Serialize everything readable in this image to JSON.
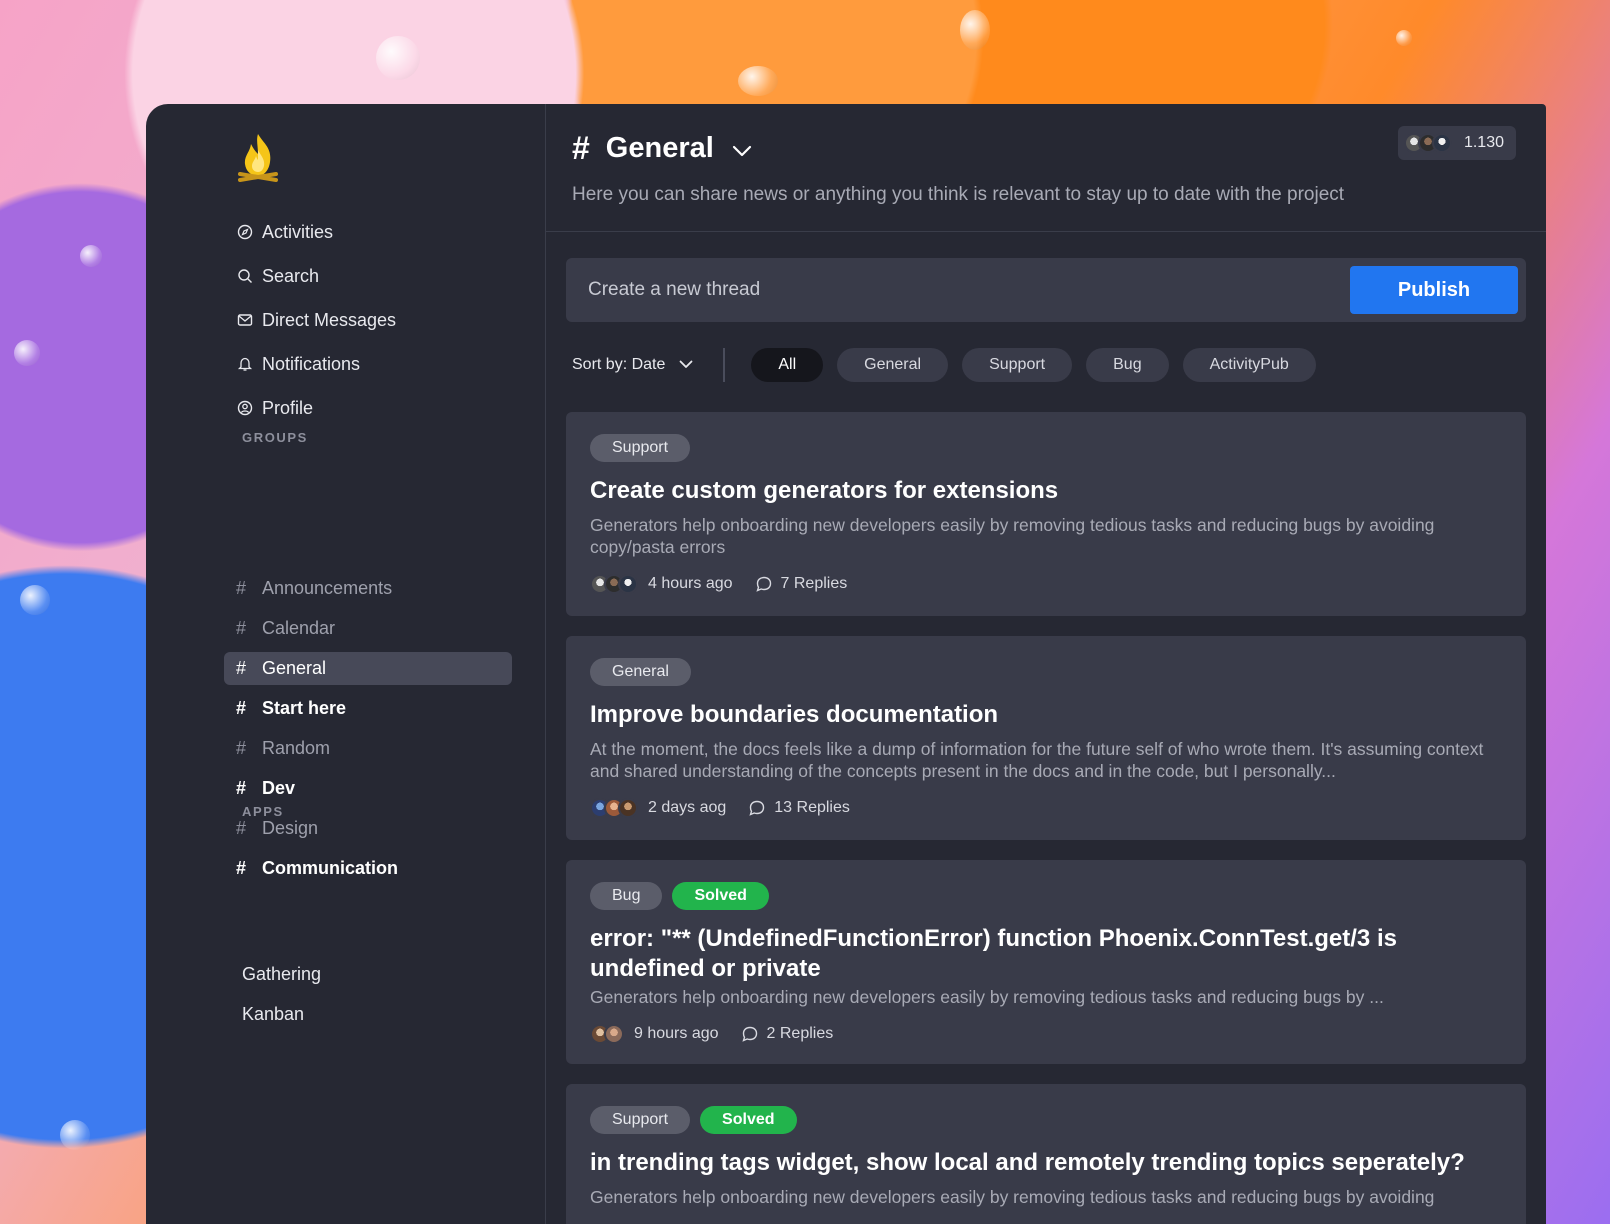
{
  "nav": {
    "items": [
      {
        "label": "Activities",
        "icon": "compass-icon"
      },
      {
        "label": "Search",
        "icon": "search-icon"
      },
      {
        "label": "Direct Messages",
        "icon": "envelope-icon"
      },
      {
        "label": "Notifications",
        "icon": "bell-icon"
      },
      {
        "label": "Profile",
        "icon": "user-circle-icon"
      }
    ]
  },
  "groups": {
    "title": "GROUPS",
    "items": [
      {
        "label": "Announcements"
      },
      {
        "label": "Calendar"
      },
      {
        "label": "General"
      },
      {
        "label": "Start here"
      },
      {
        "label": "Random"
      },
      {
        "label": "Dev"
      },
      {
        "label": "Design"
      },
      {
        "label": "Communication"
      }
    ]
  },
  "apps": {
    "title": "APPS",
    "items": [
      {
        "label": "Gathering"
      },
      {
        "label": "Kanban"
      }
    ]
  },
  "channel": {
    "hash": "#",
    "name": "General",
    "description": "Here you can share news or anything you think is relevant to stay up to date with the project",
    "member_count": "1.130"
  },
  "composer": {
    "placeholder": "Create a new thread",
    "publish_label": "Publish"
  },
  "filters": {
    "sort_label": "Sort by: Date",
    "pills": [
      "All",
      "General",
      "Support",
      "Bug",
      "ActivityPub"
    ]
  },
  "threads": [
    {
      "tags": [
        "Support"
      ],
      "title": "Create custom generators for extensions",
      "body": "Generators help onboarding new developers easily by removing tedious tasks and reducing bugs by avoiding copy/pasta errors",
      "time": "4 hours ago",
      "replies": "7 Replies"
    },
    {
      "tags": [
        "General"
      ],
      "title": "Improve boundaries documentation",
      "body": "At the moment, the docs feels like a dump of information for the future self of who wrote them. It's assuming context and shared understanding of the concepts present in the docs and in the code, but I personally...",
      "time": "2 days aog",
      "replies": "13 Replies"
    },
    {
      "tags": [
        "Bug"
      ],
      "status": "Solved",
      "title": "error: \"** (UndefinedFunctionError) function Phoenix.ConnTest.get/3 is undefined or private",
      "body": "Generators help onboarding new developers easily by removing tedious tasks and reducing bugs by ...",
      "time": "9 hours ago",
      "replies": "2 Replies"
    },
    {
      "tags": [
        "Support"
      ],
      "status": "Solved",
      "title": "in trending tags widget, show local and remotely trending topics seperately?",
      "body": "Generators help onboarding new developers easily by removing tedious tasks and reducing bugs by avoiding"
    }
  ],
  "colors": {
    "panel": "#262833",
    "card": "#393b49",
    "accent": "#2176f0",
    "solved": "#22b44c"
  }
}
